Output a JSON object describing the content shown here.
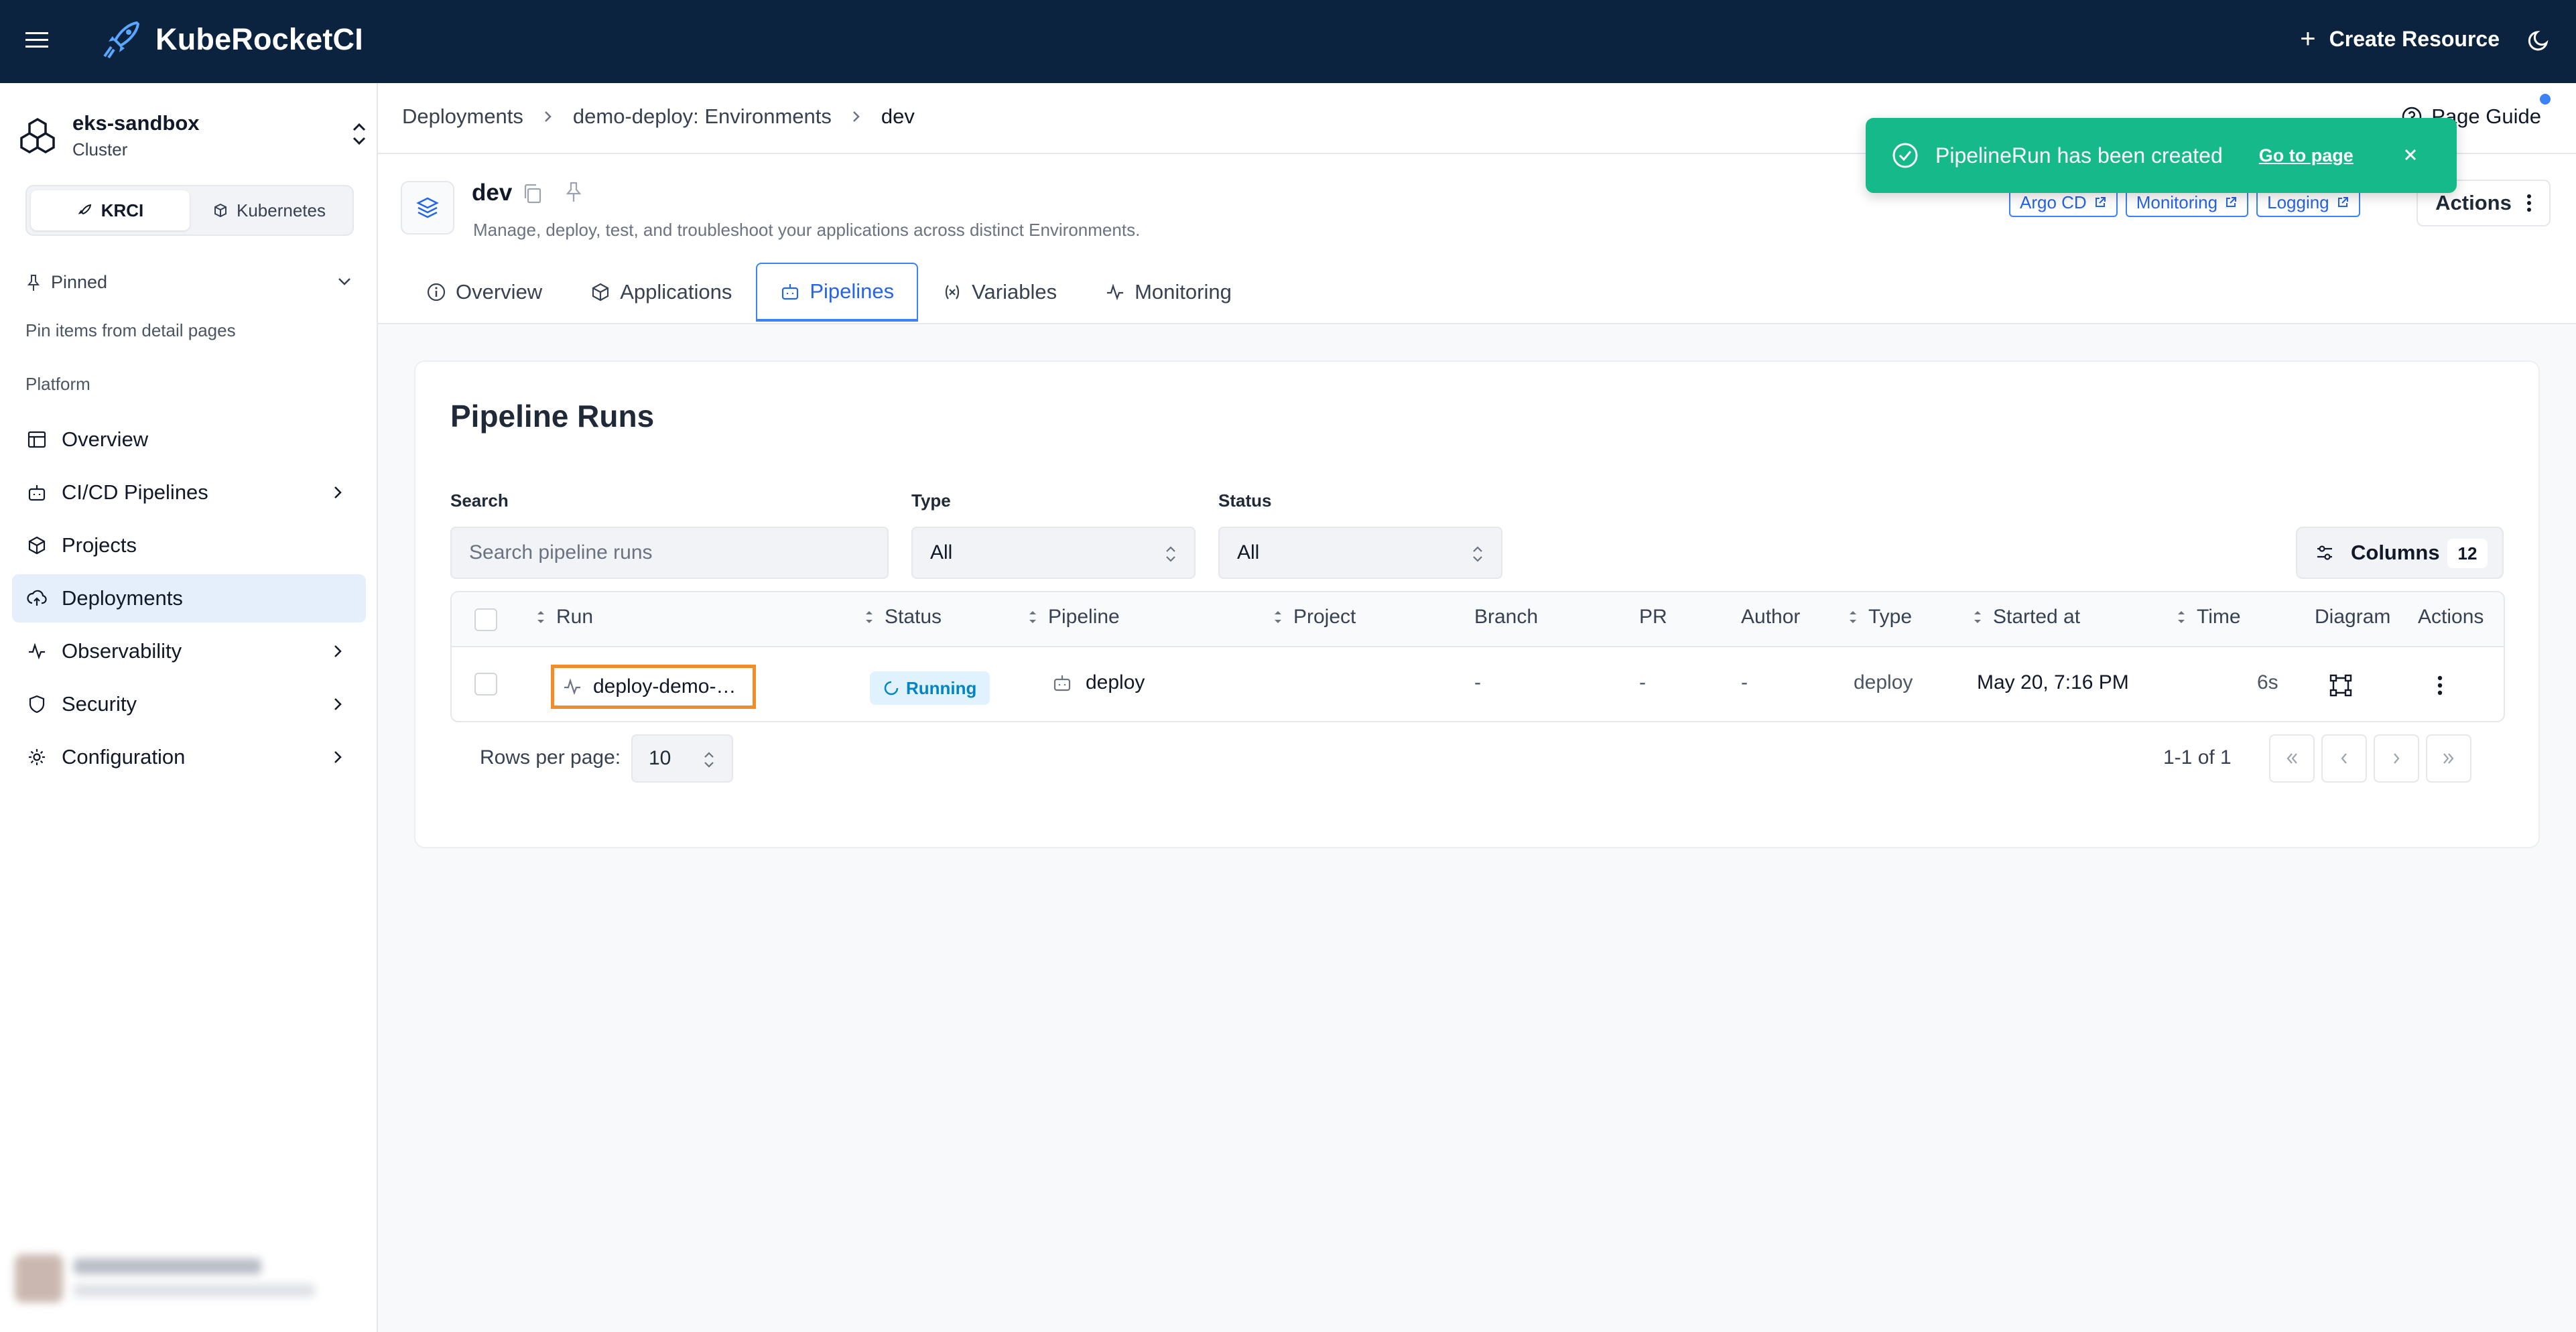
{
  "header": {
    "brand": "KubeRocketCI",
    "create_label": "Create Resource",
    "brand_color": "#0c2340"
  },
  "sidebar": {
    "cluster_name": "eks-sandbox",
    "cluster_type": "Cluster",
    "mode_krci": "KRCI",
    "mode_kubernetes": "Kubernetes",
    "pinned_label": "Pinned",
    "pinned_hint": "Pin items from detail pages",
    "section_label": "Platform",
    "items": [
      {
        "label": "Overview",
        "icon": "overview-icon"
      },
      {
        "label": "CI/CD Pipelines",
        "icon": "pipelines-icon"
      },
      {
        "label": "Projects",
        "icon": "projects-icon"
      },
      {
        "label": "Deployments",
        "icon": "deployments-icon"
      },
      {
        "label": "Observability",
        "icon": "observability-icon"
      },
      {
        "label": "Security",
        "icon": "security-icon"
      },
      {
        "label": "Configuration",
        "icon": "configuration-icon"
      }
    ]
  },
  "breadcrumb": {
    "items": [
      "Deployments",
      "demo-deploy: Environments",
      "dev"
    ],
    "page_guide": "Page Guide"
  },
  "environment": {
    "title": "dev",
    "description": "Manage, deploy, test, and troubleshoot your applications across distinct Environments.",
    "links": [
      "Argo CD",
      "Monitoring",
      "Logging"
    ],
    "actions_label": "Actions",
    "tabs": [
      "Overview",
      "Applications",
      "Pipelines",
      "Variables",
      "Monitoring"
    ],
    "active_tab": "Pipelines"
  },
  "toast": {
    "message": "PipelineRun has been created",
    "link": "Go to page",
    "color": "#16b989"
  },
  "pipeline_runs": {
    "title": "Pipeline Runs",
    "search_label": "Search",
    "search_placeholder": "Search pipeline runs",
    "type_label": "Type",
    "type_value": "All",
    "status_label": "Status",
    "status_value": "All",
    "columns_label": "Columns",
    "columns_count": "12",
    "headers": [
      "Run",
      "Status",
      "Pipeline",
      "Project",
      "Branch",
      "PR",
      "Author",
      "Type",
      "Started at",
      "Time",
      "Diagram",
      "Actions"
    ],
    "rows": [
      {
        "run": "deploy-demo-…",
        "status": "Running",
        "pipeline": "deploy",
        "project": "",
        "branch": "-",
        "pr": "-",
        "author": "-",
        "type": "deploy",
        "started_at": "May 20, 7:16 PM",
        "time": "6s"
      }
    ],
    "rows_per_page_label": "Rows per page:",
    "rows_per_page": "10",
    "page_info": "1-1 of 1"
  }
}
